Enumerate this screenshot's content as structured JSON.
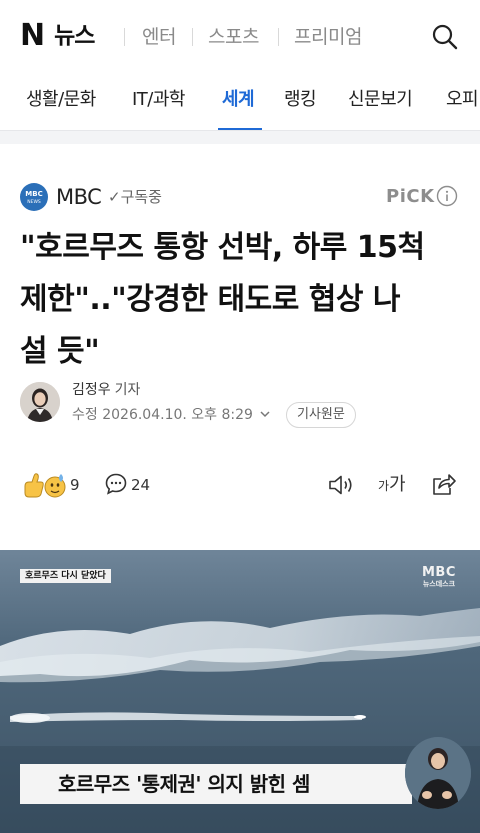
{
  "header": {
    "logo_letter": "N",
    "logo_text": "뉴스",
    "sections": [
      "엔터",
      "스포츠",
      "프리미엄"
    ],
    "search_icon": "search-icon"
  },
  "categories": [
    {
      "label": "생활/문화",
      "active": false
    },
    {
      "label": "IT/과학",
      "active": false
    },
    {
      "label": "세계",
      "active": true
    },
    {
      "label": "랭킹",
      "active": false
    },
    {
      "label": "신문보기",
      "active": false
    },
    {
      "label": "오피니언",
      "active": false
    }
  ],
  "colors": {
    "accent": "#1f6ad6",
    "press_logo": "#2b6fb8"
  },
  "article": {
    "press": {
      "name": "MBC",
      "subscribe_label": "구독중",
      "logo_text": "MBC NEWS",
      "pick_label": "PiCK"
    },
    "headline_lines": [
      "\"호르무즈 통항 선박, 하루 15척",
      "제한\"..\"강경한 태도로 협상 나",
      "설 듯\""
    ],
    "author": {
      "name": "김정우",
      "role": "기자"
    },
    "date_label": "수정",
    "date": "2026.04.10. 오후 8:29",
    "original_label": "기사원문",
    "reactions": {
      "count": "9",
      "comments": "24"
    },
    "font_size_label_small": "가",
    "font_size_label_big": "가"
  },
  "media": {
    "top_caption": "호르무즈 다시 닫았다",
    "broadcaster_main": "MBC",
    "broadcaster_sub": "뉴스데스크",
    "subtitle": "호르무즈 '통제권' 의지 밝힌 셈"
  }
}
